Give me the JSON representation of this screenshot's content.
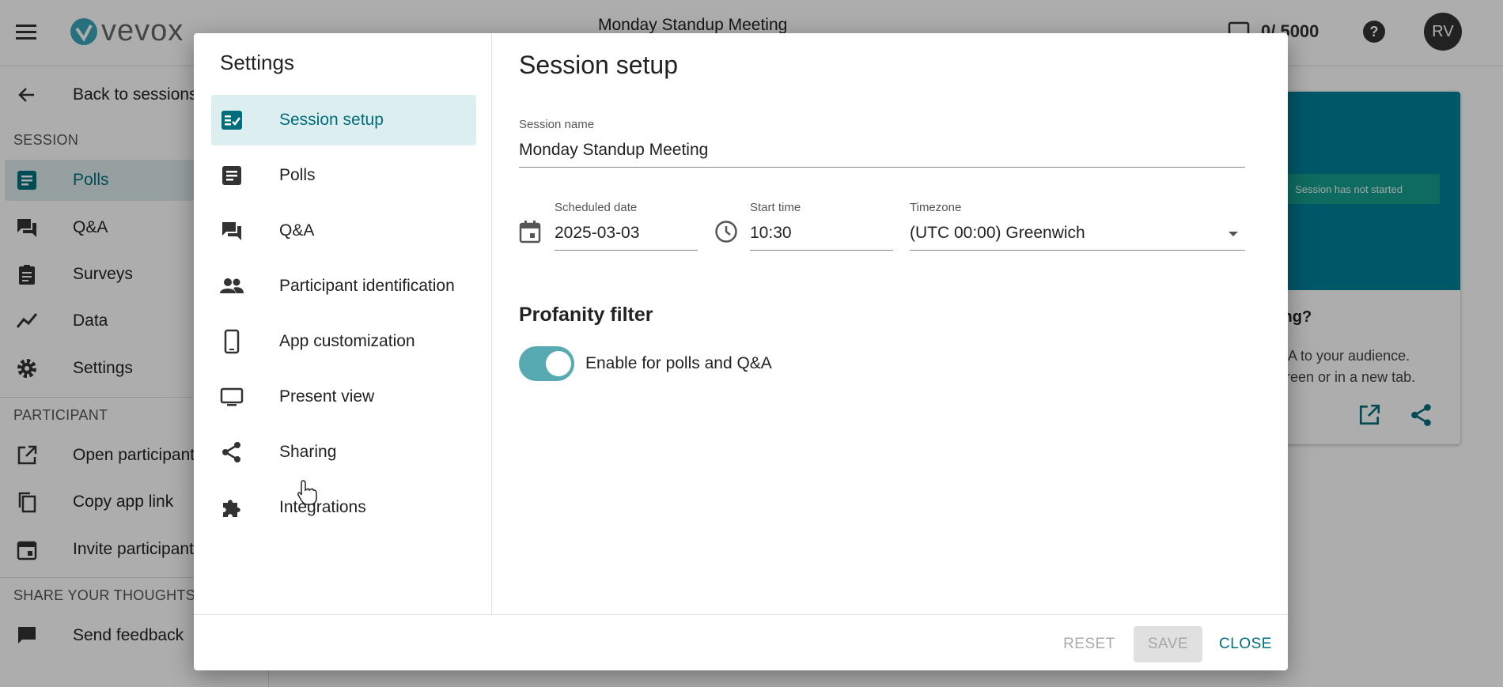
{
  "topbar": {
    "brand": "vevox",
    "meeting_title": "Monday Standup Meeting",
    "participant_count": "0/ 5000",
    "avatar_initials": "RV"
  },
  "sidebar": {
    "back_label": "Back to sessions",
    "session_header": "SESSION",
    "session_items": [
      {
        "label": "Polls",
        "icon": "polls-icon"
      },
      {
        "label": "Q&A",
        "icon": "qa-icon"
      },
      {
        "label": "Surveys",
        "icon": "clipboard-icon"
      },
      {
        "label": "Data",
        "icon": "chart-line-icon"
      },
      {
        "label": "Settings",
        "icon": "gear-icon"
      }
    ],
    "participant_header": "PARTICIPANT",
    "participant_items": [
      {
        "label": "Open participant app",
        "icon": "open-external-icon"
      },
      {
        "label": "Copy app link",
        "icon": "copy-icon"
      },
      {
        "label": "Invite participants",
        "icon": "calendar-icon"
      }
    ],
    "share_header": "SHARE YOUR THOUGHTS",
    "feedback_label": "Send feedback"
  },
  "preview": {
    "status": "Session has not started",
    "heading": "ing?",
    "line1": "&A to your audience.",
    "line2": "creen or in a new tab."
  },
  "dialog": {
    "title": "Settings",
    "nav": [
      {
        "label": "Session setup",
        "icon": "session-setup-icon",
        "active": true
      },
      {
        "label": "Polls",
        "icon": "polls-icon"
      },
      {
        "label": "Q&A",
        "icon": "qa-icon"
      },
      {
        "label": "Participant identification",
        "icon": "people-icon"
      },
      {
        "label": "App customization",
        "icon": "phone-icon"
      },
      {
        "label": "Present view",
        "icon": "monitor-icon"
      },
      {
        "label": "Sharing",
        "icon": "share-icon"
      },
      {
        "label": "Integrations",
        "icon": "puzzle-icon"
      }
    ],
    "section_title": "Session setup",
    "session_name_label": "Session name",
    "session_name_value": "Monday Standup Meeting",
    "scheduled_date_label": "Scheduled date",
    "scheduled_date_value": "2025-03-03",
    "start_time_label": "Start time",
    "start_time_value": "10:30",
    "timezone_label": "Timezone",
    "timezone_value": "(UTC 00:00) Greenwich",
    "profanity_title": "Profanity filter",
    "profanity_toggle_label": "Enable for polls and Q&A",
    "profanity_enabled": true,
    "buttons": {
      "reset": "RESET",
      "save": "SAVE",
      "close": "CLOSE"
    }
  },
  "colors": {
    "accent": "#00707e",
    "toggle_track": "#58aab2",
    "active_bg": "#ddeef0"
  }
}
